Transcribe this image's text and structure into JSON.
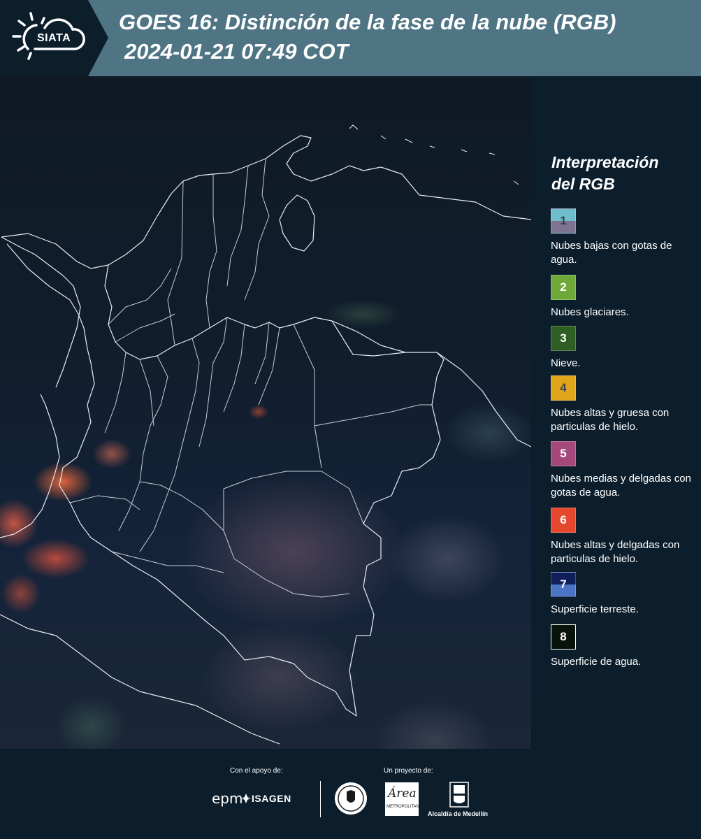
{
  "header": {
    "logo_text": "SIATA",
    "title_line1": "GOES 16: Distinción de la fase de la nube (RGB)",
    "title_line2": "2024-01-21 07:49 COT",
    "colors": {
      "band": "#4f7585",
      "logo_box": "#0d1e2b"
    }
  },
  "legend": {
    "title": "Interpretación\ndel RGB",
    "items": [
      {
        "number": "1",
        "label": "Nubes bajas con gotas de agua.",
        "color_top": "#6fbccb",
        "color_bottom": "#7d7393",
        "number_color": "#3f3f4a"
      },
      {
        "number": "2",
        "label": "Nubes glaciares.",
        "color_top": "#6ea839",
        "color_bottom": "#6ea839",
        "number_color": "#ffffff"
      },
      {
        "number": "3",
        "label": "Nieve.",
        "color_top": "#2f5e22",
        "color_bottom": "#2f5e22",
        "number_color": "#ffffff"
      },
      {
        "number": "4",
        "label": "Nubes altas y gruesa con particulas de hielo.",
        "color_top": "#e1a51c",
        "color_bottom": "#e1a51c",
        "number_color": "#3f3f4a"
      },
      {
        "number": "5",
        "label": "Nubes medias y delgadas con gotas de agua.",
        "color_top": "#a5487c",
        "color_bottom": "#a5487c",
        "number_color": "#ffffff"
      },
      {
        "number": "6",
        "label": "Nubes altas y delgadas con particulas de hielo.",
        "color_top": "#e5482c",
        "color_bottom": "#e5482c",
        "number_color": "#ffffff"
      },
      {
        "number": "7",
        "label": "Superficie terreste.",
        "color_top": "#101e5a",
        "color_bottom": "#4b74c6",
        "number_color": "#ffffff"
      },
      {
        "number": "8",
        "label": "Superficie de agua.",
        "color_top": "#0a120c",
        "color_bottom": "#0a120c",
        "number_color": "#ffffff"
      }
    ]
  },
  "footer": {
    "support_label": "Con el apoyo de:",
    "project_label": "Un proyecto de:",
    "epm_logo": "epm",
    "isagen_logo": "ISAGEN",
    "area_script": "Área",
    "area_subtitle": "METROPOLITANA Valle de Aburrá",
    "alcaldia_label": "Alcaldía de Medellín"
  }
}
